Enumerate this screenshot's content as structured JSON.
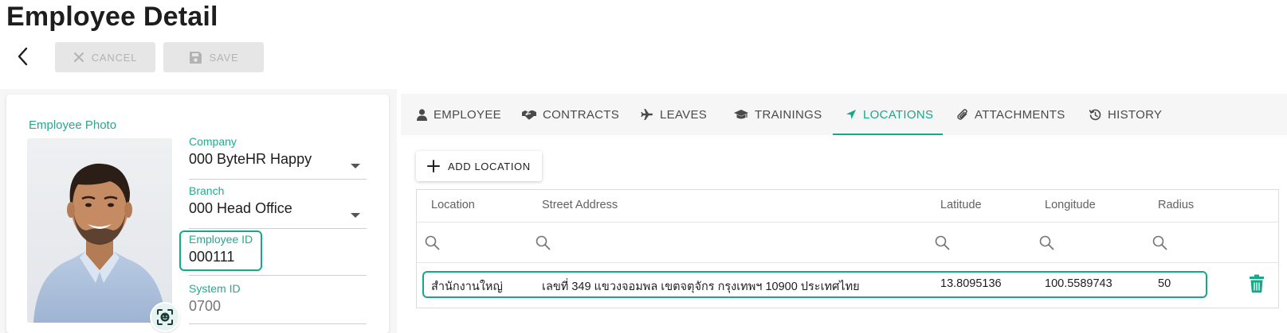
{
  "page": {
    "title": "Employee Detail"
  },
  "toolbar": {
    "cancel_label": "CANCEL",
    "save_label": "SAVE"
  },
  "left_panel": {
    "photo_label": "Employee Photo",
    "company": {
      "label": "Company",
      "value": "000 ByteHR Happy"
    },
    "branch": {
      "label": "Branch",
      "value": "000 Head Office"
    },
    "employee_id": {
      "label": "Employee ID",
      "value": "000111"
    },
    "system_id": {
      "label": "System ID",
      "value": "0700"
    }
  },
  "tabs": [
    {
      "label": "EMPLOYEE",
      "icon": "person-icon"
    },
    {
      "label": "CONTRACTS",
      "icon": "handshake-icon"
    },
    {
      "label": "LEAVES",
      "icon": "plane-icon"
    },
    {
      "label": "TRAININGS",
      "icon": "graduation-cap-icon"
    },
    {
      "label": "LOCATIONS",
      "icon": "location-arrow-icon",
      "active": true
    },
    {
      "label": "ATTACHMENTS",
      "icon": "paperclip-icon"
    },
    {
      "label": "HISTORY",
      "icon": "history-icon"
    }
  ],
  "locations": {
    "add_label": "ADD LOCATION",
    "columns": [
      "Location",
      "Street Address",
      "Latitude",
      "Longitude",
      "Radius"
    ],
    "rows": [
      {
        "location": "สำนักงานใหญ่",
        "street_address": "เลขที่ 349 แขวงจอมพล เขตจตุจักร กรุงเทพฯ 10900 ประเทศไทย",
        "latitude": "13.8095136",
        "longitude": "100.5589743",
        "radius": "50"
      }
    ]
  },
  "colors": {
    "accent": "#17a88b",
    "label_teal": "#26a88f",
    "disabled_bg": "#e6e6e6",
    "disabled_text": "#b3b3b3"
  }
}
